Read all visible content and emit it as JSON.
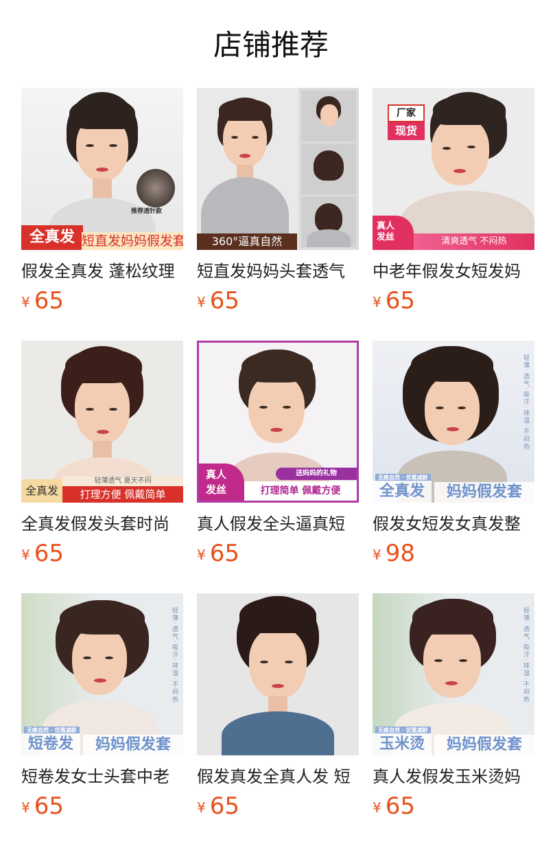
{
  "header": {
    "title": "店铺推荐"
  },
  "currency": "¥",
  "products": [
    {
      "title": "假发全真发 蓬松纹理",
      "price": "65",
      "overlay": {
        "badge": "全真发",
        "banner": "短直发妈妈假发套",
        "note": "推荐透针款"
      }
    },
    {
      "title": "短直发妈妈头套透气",
      "price": "65",
      "overlay": {
        "banner": "360°逼真自然"
      }
    },
    {
      "title": "中老年假发女短发妈",
      "price": "65",
      "overlay": {
        "stamp1": "厂家",
        "stamp2": "现货",
        "badge1": "真人",
        "badge2": "发丝",
        "banner": "清爽透气 不闷热"
      }
    },
    {
      "title": "全真发假发头套时尚",
      "price": "65",
      "overlay": {
        "badge": "全真发",
        "top": "轻薄透气  夏天不闷",
        "banner": "打理方便 佩戴简单"
      }
    },
    {
      "title": "真人假发全头逼真短",
      "price": "65",
      "overlay": {
        "badge1": "真人",
        "badge2": "发丝",
        "top": "送妈妈的礼物",
        "banner": "打理简单  佩戴方便"
      }
    },
    {
      "title": "假发女短发女真发整",
      "price": "98",
      "overlay": {
        "small": "无痕自然 · 优雅减龄",
        "left": "全真发",
        "right": "妈妈假发套",
        "side": "轻薄·透气·吸汗·排湿·不闷热"
      }
    },
    {
      "title": "短卷发女士头套中老",
      "price": "65",
      "overlay": {
        "small": "无痕自然 · 优雅减龄",
        "left": "短卷发",
        "right": "妈妈假发套",
        "side": "轻薄·透气·吸汗·排湿·不闷热"
      }
    },
    {
      "title": "假发真发全真人发 短",
      "price": "65"
    },
    {
      "title": "真人发假发玉米烫妈",
      "price": "65",
      "overlay": {
        "small": "无痕自然 · 优雅减龄",
        "left": "玉米烫",
        "right": "妈妈假发套",
        "side": "轻薄·透气·吸汗·排湿·不闷热"
      }
    }
  ],
  "colors": {
    "price": "#e8501a",
    "badge_red": "#d8312a",
    "badge_pink": "#e0305f",
    "banner_blue": "#7f9fd0"
  }
}
